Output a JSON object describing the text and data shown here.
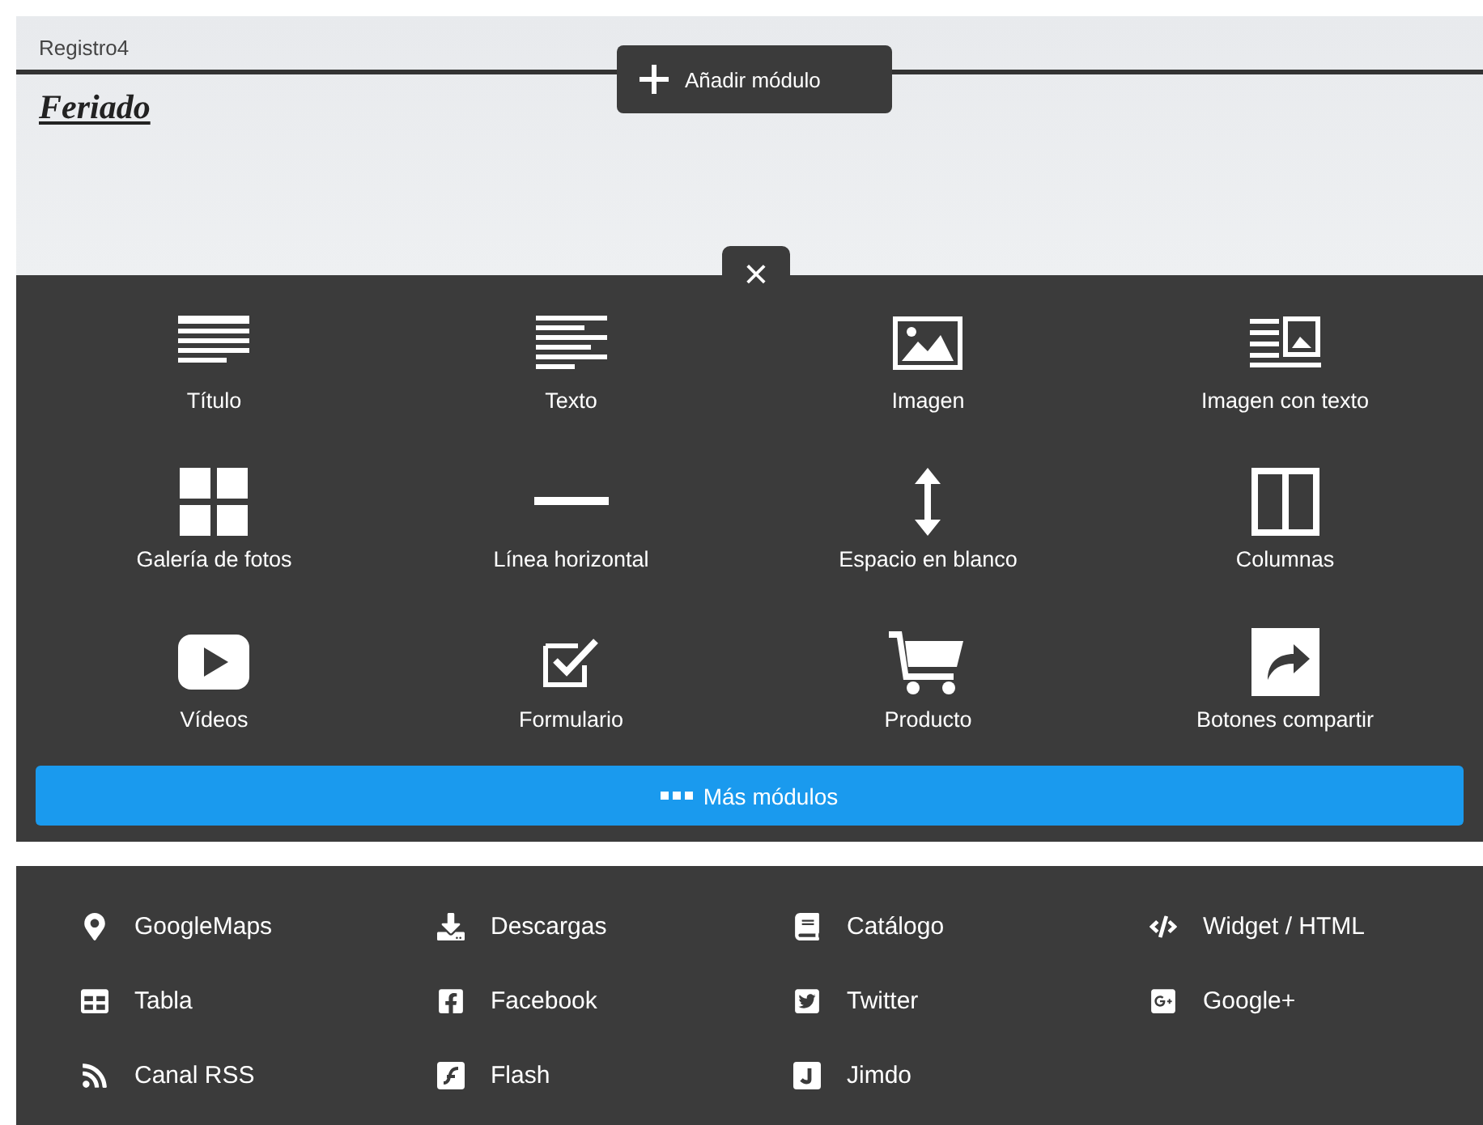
{
  "section": {
    "name": "Registro4",
    "heading": "Feriado"
  },
  "add_module_button": {
    "label": "Añadir módulo"
  },
  "close_tab": {
    "label": "×"
  },
  "modules": [
    {
      "label": "Título"
    },
    {
      "label": "Texto"
    },
    {
      "label": "Imagen"
    },
    {
      "label": "Imagen con texto"
    },
    {
      "label": "Galería de fotos"
    },
    {
      "label": "Línea horizontal"
    },
    {
      "label": "Espacio en blanco"
    },
    {
      "label": "Columnas"
    },
    {
      "label": "Vídeos"
    },
    {
      "label": "Formulario"
    },
    {
      "label": "Producto"
    },
    {
      "label": "Botones compartir"
    }
  ],
  "more_button": {
    "label": "Más módulos"
  },
  "extra_modules": [
    {
      "label": "GoogleMaps"
    },
    {
      "label": "Descargas"
    },
    {
      "label": "Catálogo"
    },
    {
      "label": "Widget / HTML"
    },
    {
      "label": "Tabla"
    },
    {
      "label": "Facebook"
    },
    {
      "label": "Twitter"
    },
    {
      "label": "Google+"
    },
    {
      "label": "Canal RSS"
    },
    {
      "label": "Flash"
    },
    {
      "label": "Jimdo"
    }
  ]
}
